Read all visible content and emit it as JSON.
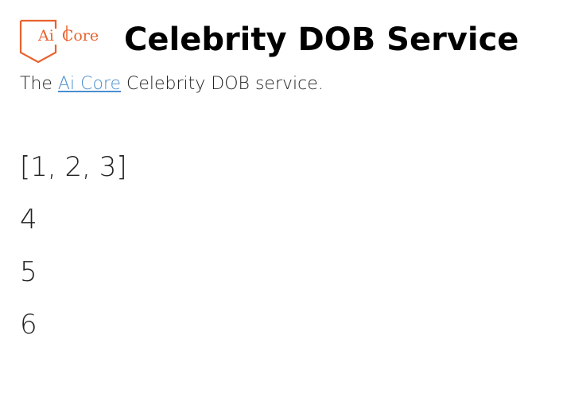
{
  "header": {
    "logo": {
      "text_ai": "Ai",
      "text_core": "Core",
      "brand_color": "#e8622f"
    },
    "title": "Celebrity DOB Service"
  },
  "intro": {
    "prefix": "The",
    "link_text": "Ai Core",
    "suffix": "Celebrity DOB service.",
    "link_color": "#4a8fd0"
  },
  "values": [
    "[1, 2, 3]",
    "4",
    "5",
    "6"
  ]
}
